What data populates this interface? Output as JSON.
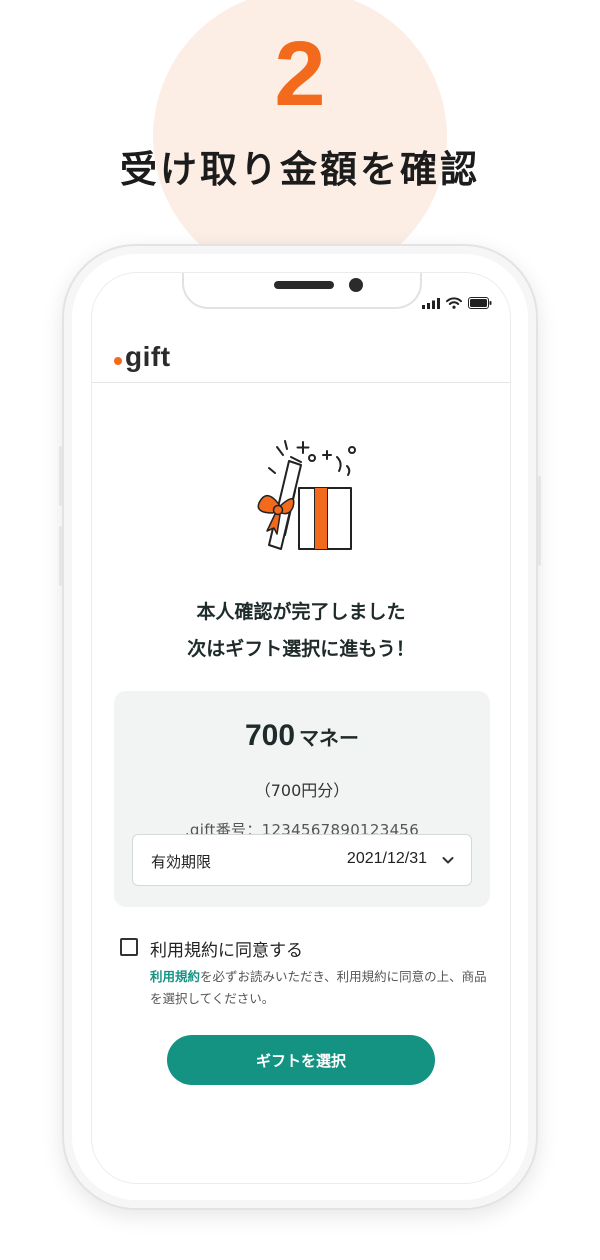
{
  "step": {
    "number": "2",
    "title": "受け取り金額を確認",
    "accent_color": "#f26b1d",
    "circle_color": "#fdeee5"
  },
  "app": {
    "logo_text": "gift",
    "logo_dot_color": "#f26b1d"
  },
  "status_bar": {
    "icons": [
      "signal-icon",
      "wifi-icon",
      "battery-icon"
    ]
  },
  "illustration": {
    "name": "open-gift-box-illustration"
  },
  "message": {
    "line1": "本人確認が完了しました",
    "line2": "次はギフト選択に進もう！"
  },
  "amount_card": {
    "amount_value": "700",
    "amount_unit": "マネー",
    "amount_yen": "（700円分）",
    "gift_number": ".gift番号：1234567890123456",
    "expiry_label": "有効期限",
    "expiry_value": "2021/12/31",
    "expiry_icon": "chevron-down-icon"
  },
  "agreement": {
    "checkbox_label": "利用規約に同意する",
    "checked": false,
    "terms_link_text": "利用規約",
    "note_rest": "を必ずお読みいただき、利用規約に同意の上、商品を選択してください。"
  },
  "primary_button": {
    "label": "ギフトを選択",
    "color": "#149383"
  }
}
